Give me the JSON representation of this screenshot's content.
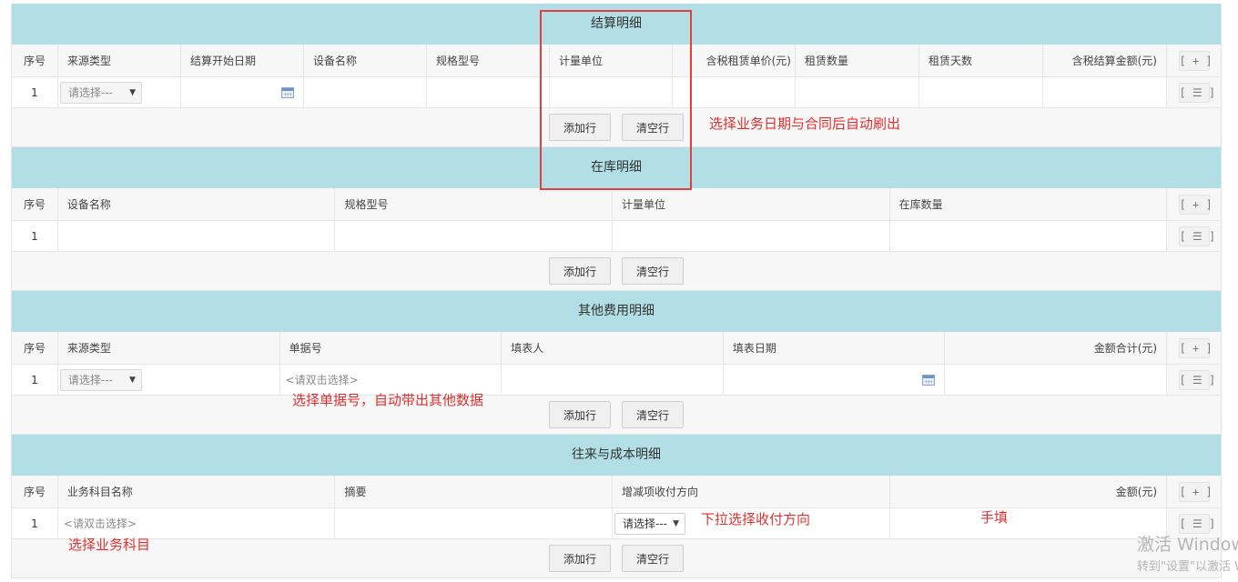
{
  "tool_add": "[ + ]",
  "tool_menu": "[ ☰ ]",
  "btn_add_row": "添加行",
  "btn_clear_row": "清空行",
  "settlement": {
    "title": "结算明细",
    "headers": [
      "序号",
      "来源类型",
      "结算开始日期",
      "设备名称",
      "规格型号",
      "计量单位",
      "",
      "含税租赁单价(元)",
      "租赁数量",
      "租赁天数",
      "含税结算金额(元)"
    ],
    "row": {
      "index": "1",
      "source_select": "请选择---"
    }
  },
  "stock": {
    "title": "在库明细",
    "headers": [
      "序号",
      "设备名称",
      "规格型号",
      "计量单位",
      "在库数量"
    ],
    "row": {
      "index": "1"
    }
  },
  "other_fees": {
    "title": "其他费用明细",
    "headers": [
      "序号",
      "来源类型",
      "单据号",
      "填表人",
      "填表日期",
      "金额合计(元)"
    ],
    "row": {
      "index": "1",
      "source_select": "请选择---",
      "doc_placeholder": "<请双击选择>"
    }
  },
  "accounts": {
    "title": "往来与成本明细",
    "headers": [
      "序号",
      "业务科目名称",
      "摘要",
      "增减项收付方向",
      "金额(元)"
    ],
    "row": {
      "index": "1",
      "subject_placeholder": "<请双击选择>",
      "direction_select": "请选择---"
    }
  },
  "annotations": {
    "settlement_note": "选择业务日期与合同后自动刷出",
    "doc_note": "选择单据号，自动带出其他数据",
    "direction_note": "下拉选择收付方向",
    "manual_note": "手填",
    "subject_note": "选择业务科目"
  },
  "watermark": {
    "line1": "激活 Windows",
    "line2": "转到\"设置\"以激活 Windows。"
  },
  "colors": {
    "section_header": "#b2dfe5",
    "annotation": "#e03030",
    "highlight_box": "#e04040"
  }
}
